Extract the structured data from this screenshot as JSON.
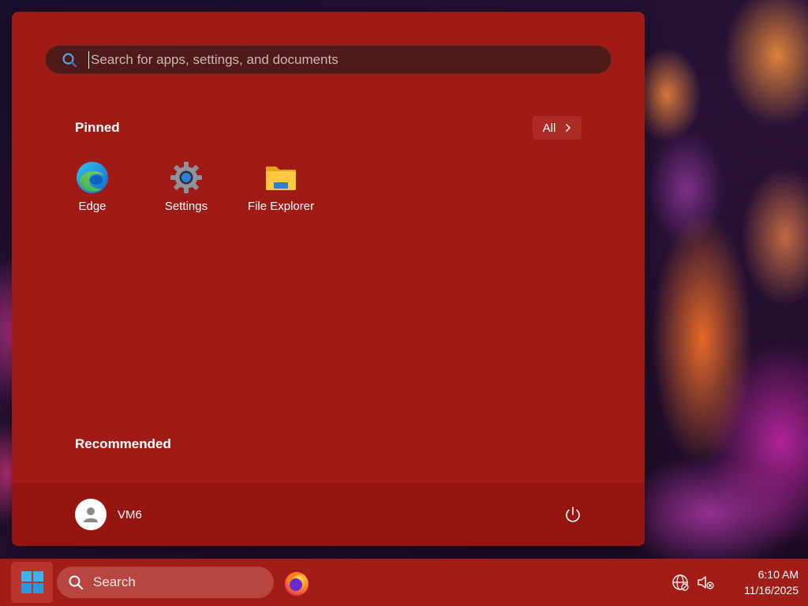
{
  "start_menu": {
    "search": {
      "placeholder": "Search for apps, settings, and documents",
      "value": ""
    },
    "pinned": {
      "title": "Pinned",
      "all_button_label": "All",
      "apps": [
        {
          "label": "Edge",
          "icon": "edge-icon"
        },
        {
          "label": "Settings",
          "icon": "settings-gear-icon"
        },
        {
          "label": "File Explorer",
          "icon": "folder-icon"
        }
      ]
    },
    "recommended": {
      "title": "Recommended"
    },
    "footer": {
      "user_name": "VM6",
      "user_icon": "user-avatar-icon",
      "power_icon": "power-icon"
    }
  },
  "taskbar": {
    "start_icon": "windows-logo-icon",
    "search_label": "Search",
    "pinned_apps": [
      {
        "name": "Firefox",
        "icon": "firefox-icon"
      }
    ],
    "tray": {
      "icons": [
        "network-globe-icon",
        "speaker-muted-icon"
      ],
      "time": "6:10 AM",
      "date": "11/16/2025"
    }
  },
  "colors": {
    "accent": "#a01a16",
    "taskbar": "#a21c18",
    "footer": "#951511"
  }
}
